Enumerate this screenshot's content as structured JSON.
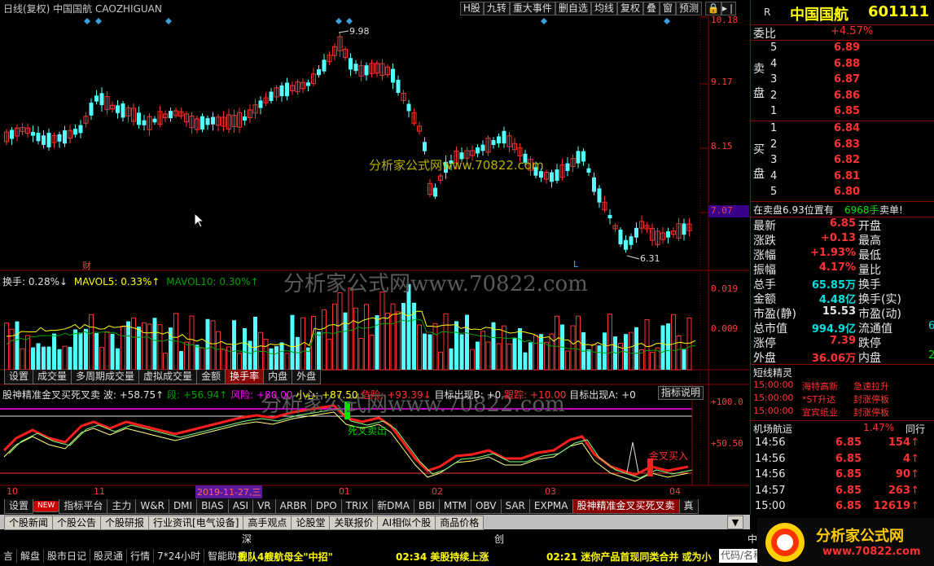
{
  "header": {
    "title": "日线(复权)  中国国航  CAOZHIGUAN",
    "buttons": [
      "H股",
      "九转",
      "重大事件",
      "删自选",
      "均线",
      "复权",
      "叠",
      "窗",
      "预测"
    ],
    "lock_icon": "lock-icon",
    "arrow_icon": "arrow-icon"
  },
  "price_axis": [
    "10.18",
    "9.17",
    "8.15",
    "7.07"
  ],
  "price_axis_current": "7.07",
  "annotations": {
    "high": "9.98",
    "low": "6.31",
    "cai": "财",
    "L": "L"
  },
  "watermarks": [
    "分析家公式网www.70822.com",
    "分析家公式网www.70822.com",
    "分析家公式网www.70822.com"
  ],
  "volume_legend": {
    "turnover": "换手: 0.28%↓",
    "mavol5": "MAVOL5: 0.33%↑",
    "mavol10": "MAVOL10: 0.30%↑"
  },
  "volume_axis": [
    "0.019",
    "0.009"
  ],
  "volume_tabs": [
    "设置",
    "成交量",
    "多周期成交量",
    "虚拟成交量",
    "金额",
    "换手率",
    "内盘",
    "外盘"
  ],
  "indicator": {
    "name": "股神精准金叉买死叉卖",
    "wave": "波: +58.75↑",
    "segment": "段: +56.94↑",
    "risk": "风险: +80.00",
    "small": "小心: +87.50",
    "danger": "危险: +93.39↓",
    "target": "目标出现B: +0",
    "follow": "跟踪: +10.00",
    "target_a": "目标出现A: +0",
    "help_button": "指标说明",
    "axis": [
      "+100.0",
      "+50.50"
    ],
    "death_cross": "死叉卖出",
    "golden_cross": "金叉买入"
  },
  "date_axis": [
    "10",
    "11",
    "2019-11-27,三",
    "01",
    "02",
    "03",
    "04"
  ],
  "bottom_tabs": [
    "设置",
    "NEW",
    "指标平台",
    "主力",
    "W&R",
    "DMI",
    "BIAS",
    "ASI",
    "VR",
    "ARBR",
    "DPO",
    "TRIX",
    "新DMA",
    "BBI",
    "MTM",
    "OBV",
    "SAR",
    "EXPMA",
    "股神精准金叉买死叉卖",
    "真"
  ],
  "right": {
    "r_label": "R",
    "stock_name": "中国国航",
    "stock_code": "601111",
    "weibi_label": "委比",
    "weibi_value": "+4.57%",
    "sell_label": "卖盘",
    "buy_label": "买盘",
    "sells": [
      {
        "level": "5",
        "price": "6.89"
      },
      {
        "level": "4",
        "price": "6.88"
      },
      {
        "level": "3",
        "price": "6.87"
      },
      {
        "level": "2",
        "price": "6.86"
      },
      {
        "level": "1",
        "price": "6.85"
      }
    ],
    "buys": [
      {
        "level": "1",
        "price": "6.84"
      },
      {
        "level": "2",
        "price": "6.83"
      },
      {
        "level": "3",
        "price": "6.82"
      },
      {
        "level": "4",
        "price": "6.81"
      },
      {
        "level": "5",
        "price": "6.80"
      }
    ],
    "sell_notice": "在卖盘6.93位置有",
    "sell_notice_qty": "6968手",
    "sell_notice_action": "卖单!",
    "quote": [
      {
        "l": "最新",
        "v": "6.85",
        "r": "开盘"
      },
      {
        "l": "涨跌",
        "v": "+0.13",
        "r": "最高"
      },
      {
        "l": "涨幅",
        "v": "+1.93%",
        "r": "最低"
      },
      {
        "l": "振幅",
        "v": "4.17%",
        "r": "量比"
      },
      {
        "l": "总手",
        "v": "65.85万",
        "r": "换手"
      },
      {
        "l": "金额",
        "v": "4.48亿",
        "r": "换手(实)"
      },
      {
        "l": "市盈(静)",
        "v": "15.53",
        "r": "市盈(动)"
      },
      {
        "l": "总市值",
        "v": "994.9亿",
        "r": "流通值"
      },
      {
        "l": "涨停",
        "v": "7.39",
        "r": "跌停"
      },
      {
        "l": "外盘",
        "v": "36.06万",
        "r": "内盘"
      }
    ],
    "quote_extra": [
      "6",
      "2"
    ],
    "elves_title": "短线精灵",
    "elves": [
      {
        "time": "15:00:00",
        "name": "海特高新",
        "event": "急速拉升"
      },
      {
        "time": "15:00:00",
        "name": "*ST升达",
        "event": "封涨停板"
      },
      {
        "time": "15:00:00",
        "name": "宜宾纸业",
        "event": "封涨停板"
      }
    ],
    "sector_name": "机场航运",
    "sector_change": "1.47%",
    "sector_label": "同行",
    "ticks": [
      {
        "time": "14:56",
        "price": "6.85",
        "vol": "154"
      },
      {
        "time": "14:56",
        "price": "6.85",
        "vol": "4"
      },
      {
        "time": "14:56",
        "price": "6.85",
        "vol": "90"
      },
      {
        "time": "14:57",
        "price": "6.85",
        "vol": "263"
      },
      {
        "time": "15:00",
        "price": "6.85",
        "vol": "12619"
      }
    ]
  },
  "nav_tabs": [
    "个股新闻",
    "个股公告",
    "个股研报",
    "行业资讯[电气设备]",
    "高手观点",
    "论股堂",
    "关联报价",
    "AI相似个股",
    "商品价格"
  ],
  "status_row": {
    "shen": "深",
    "chuang": "创",
    "zhongxiao": "中小"
  },
  "bottom_menu": [
    "言",
    "解盘",
    "股市日记",
    "股灵通",
    "行情",
    "7*24小时",
    "智能助手"
  ],
  "tickers": [
    "舰队4艘航母全\"中招\"",
    "02:34 美股持续上涨",
    "02:21 迷你产品首现同类合并 或为小"
  ],
  "code_input": "代码/名称",
  "logo_text": "分析家公式网",
  "logo_url": "www.70822.com"
}
